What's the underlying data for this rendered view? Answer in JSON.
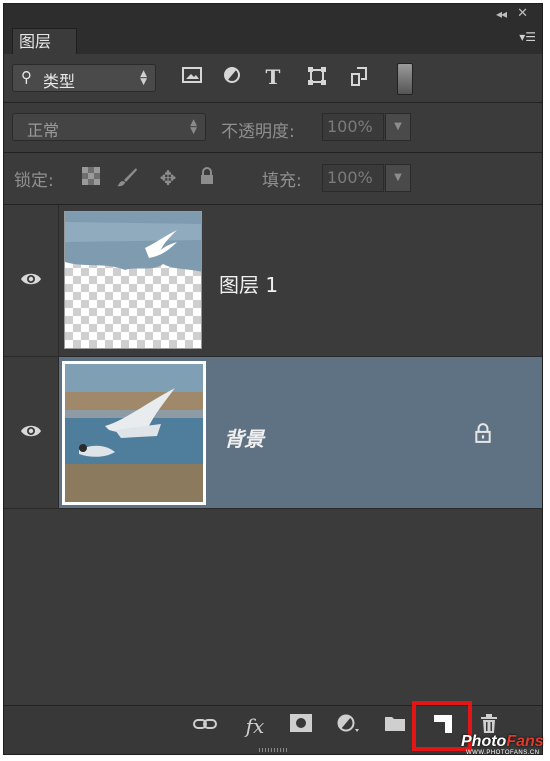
{
  "panel": {
    "tab_label": "图层"
  },
  "filter_row": {
    "kind_label": "类型",
    "filter_icons": [
      "image-filter-icon",
      "adjustment-filter-icon",
      "type-filter-icon",
      "shape-filter-icon",
      "smart-object-filter-icon",
      "filter-toggle-switch"
    ]
  },
  "blend_row": {
    "mode_value": "正常",
    "opacity_label": "不透明度:",
    "opacity_value": "100%"
  },
  "lock_row": {
    "lock_label": "锁定:",
    "fill_label": "填充:",
    "fill_value": "100%"
  },
  "layers": [
    {
      "name": "图层 1",
      "visible": true,
      "selected": false,
      "locked": false
    },
    {
      "name": "背景",
      "visible": true,
      "selected": true,
      "locked": true
    }
  ],
  "bottom_bar": {
    "icons": [
      "link-layers-icon",
      "fx-icon",
      "add-mask-icon",
      "new-adjustment-icon",
      "new-group-icon",
      "new-layer-icon",
      "delete-layer-icon"
    ]
  },
  "watermark": {
    "main_a": "Photo",
    "main_b": "Fans",
    "sub": "WWW.PHOTOFANS.CN"
  },
  "colors": {
    "panel_bg": "#3b3b3b",
    "selected_layer": "#5f7284",
    "highlight_box": "#e21616"
  }
}
